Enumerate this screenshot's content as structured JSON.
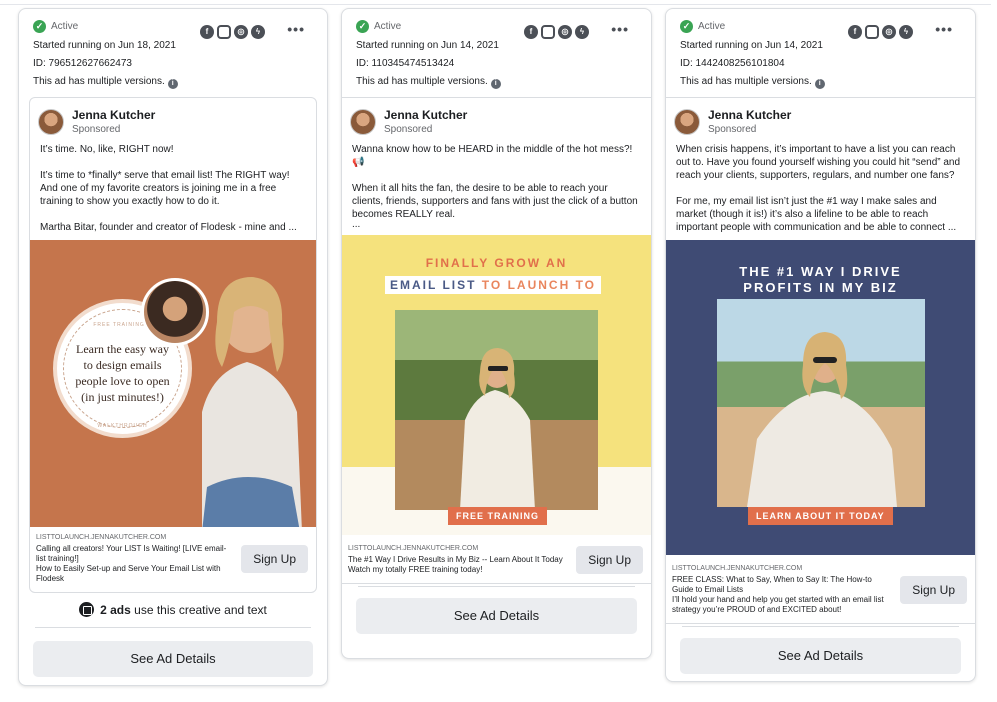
{
  "cards": [
    {
      "status": "Active",
      "started": "Started running on Jun 18, 2021",
      "id": "ID: 796512627662473",
      "versions": "This ad has multiple versions.",
      "page_name": "Jenna Kutcher",
      "sponsored": "Sponsored",
      "body": [
        "It’s time. No, like, RIGHT now!",
        "It’s time to *finally* serve that email list! The RIGHT way! And one of my favorite creators is joining me in a free training to show you exactly how to do it.",
        "Martha Bitar, founder and creator of Flodesk - mine and ..."
      ],
      "creative": {
        "badge_top": "FREE TRAINING &",
        "line1": "Learn the easy way",
        "line2": "to design emails",
        "line3": "people love to open",
        "line4": "(in just minutes!)",
        "badge_bottom": "WALKTHROUGH"
      },
      "cta": {
        "domain": "LISTTOLAUNCH.JENNAKUTCHER.COM",
        "headline": "Calling all creators! Your LIST Is Waiting! [LIVE email-list training!]",
        "description": "How to Easily Set-up and Serve Your Email List with Flodesk",
        "button": "Sign Up"
      },
      "ads_count_bold": "2 ads",
      "ads_count_rest": "use this creative and text",
      "details_button": "See Ad Details"
    },
    {
      "status": "Active",
      "started": "Started running on Jun 14, 2021",
      "id": "ID: 110345474513424",
      "versions": "This ad has multiple versions.",
      "page_name": "Jenna Kutcher",
      "sponsored": "Sponsored",
      "body": [
        "Wanna know how to be HEARD in the middle of the hot mess?! 📢",
        "When it all hits the fan, the desire to be able to reach your clients, friends, supporters and fans with just the click of a button becomes REALLY real.",
        "..."
      ],
      "creative": {
        "line1": "FINALLY GROW AN",
        "line2a": "EMAIL LIST",
        "line2b": "TO LAUNCH TO",
        "tag": "FREE TRAINING"
      },
      "cta": {
        "domain": "LISTTOLAUNCH.JENNAKUTCHER.COM",
        "headline": "The #1 Way I Drive Results in My Biz -- Learn About It Today",
        "description": "Watch my totally FREE training today!",
        "button": "Sign Up"
      },
      "details_button": "See Ad Details"
    },
    {
      "status": "Active",
      "started": "Started running on Jun 14, 2021",
      "id": "ID: 1442408256101804",
      "versions": "This ad has multiple versions.",
      "page_name": "Jenna Kutcher",
      "sponsored": "Sponsored",
      "body": [
        "When crisis happens, it’s important to have a list you can reach out to. Have you found yourself wishing you could hit “send” and reach your clients, supporters, regulars, and number one fans?",
        "For me, my email list isn’t just the #1 way I make sales and market (though it is!) it’s also a lifeline to be able to reach important people with communication and be able to connect ..."
      ],
      "creative": {
        "line1": "THE #1 WAY I DRIVE",
        "line2": "PROFITS IN MY BIZ",
        "tag": "LEARN ABOUT IT TODAY"
      },
      "cta": {
        "domain": "LISTTOLAUNCH.JENNAKUTCHER.COM",
        "headline": "FREE CLASS: What to Say, When to Say It: The How-to Guide to Email Lists",
        "description": "I’ll hold your hand and help you get started with an email list strategy you’re PROUD of and EXCITED about!",
        "button": "Sign Up"
      },
      "details_button": "See Ad Details"
    }
  ],
  "icons": {
    "check": "check-circle-icon",
    "platforms": [
      "facebook-icon",
      "instagram-icon",
      "audience-network-icon",
      "messenger-icon"
    ],
    "info": "info-icon",
    "more": "more-options-icon",
    "stack": "stack-icon"
  },
  "colors": {
    "active_green": "#3aa454",
    "creative1_bg": "#c5754c",
    "creative2_bg": "#f5e27d",
    "creative3_bg": "#3f4b74",
    "tag_orange": "#e16f4b"
  }
}
